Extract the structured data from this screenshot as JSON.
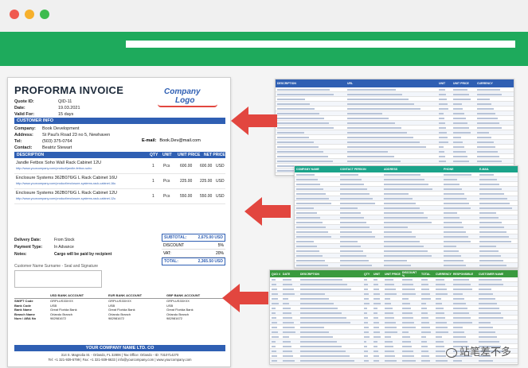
{
  "invoice": {
    "title": "PROFORMA INVOICE",
    "meta": [
      {
        "k": "Quote ID:",
        "v": "QID-11"
      },
      {
        "k": "Date:",
        "v": "19.03.2021"
      },
      {
        "k": "Valid For:",
        "v": "15 days"
      }
    ],
    "logo_line1": "Company",
    "logo_line2": "Logo",
    "customer_header": "CUSTOMER INFO",
    "customer": [
      {
        "k": "Company:",
        "v": "Book Development"
      },
      {
        "k": "Address:",
        "v": "St Paul's Road 23 no 5, Newhaven"
      },
      {
        "k": "Tel:",
        "v": "(503) 375-0764"
      },
      {
        "k": "Contact:",
        "v": "Beatriz Stewart"
      }
    ],
    "email_label": "E-mail:",
    "email_value": "Book.Dev@mail.com",
    "columns": {
      "description": "DESCRIPTION",
      "qty": "QTY",
      "unit": "UNIT",
      "unit_price": "UNIT PRICE",
      "net_price": "NET PRICE"
    },
    "items": [
      {
        "desc": "Jandle Fetbox Soho Wall Rack Cabinet 12U",
        "url": "http://www.yourcompany.com/product/jandle-fetbox-soho",
        "qty": "1",
        "unit": "Pcs",
        "unit_price": "600.00",
        "net": "600.00",
        "cur": "USD"
      },
      {
        "desc": "Enclosure Systems 362B076/G L Rack Cabinet 16U",
        "url": "http://www.yourcompany.com/product/enclosure-systems-rack-cabinet-16u",
        "qty": "1",
        "unit": "Pcs",
        "unit_price": "225.00",
        "net": "225.00",
        "cur": "USD"
      },
      {
        "desc": "Enclosure Systems 362B076/G L Rack Cabinet 12U",
        "url": "http://www.yourcompany.com/product/enclosure-systems-rack-cabinet-12u",
        "qty": "1",
        "unit": "Pcs",
        "unit_price": "550.00",
        "net": "550.00",
        "cur": "USD"
      }
    ],
    "terms": [
      {
        "k": "Delivery Date:",
        "v": "From Stock"
      },
      {
        "k": "Payment Type:",
        "v": "In Advance"
      },
      {
        "k": "Notes:",
        "v": "Cargo will be paid by recipient"
      }
    ],
    "totals": [
      {
        "k": "SUBTOTAL:",
        "v": "2,675.00 USD"
      },
      {
        "k": "DISCOUNT",
        "v": "5%"
      },
      {
        "k": "VAT:",
        "v": "20%"
      },
      {
        "k": "TOTAL:",
        "v": "2,365.50 USD"
      }
    ],
    "signature_label": "Customer Name Surname - Seal and Signature",
    "bank_headers": [
      "USD BANK ACCOUNT",
      "EUR BANK ACCOUNT",
      "GBP BANK ACCOUNT"
    ],
    "bank_rows": [
      {
        "k": "SWIFT Code",
        "v": [
          "GRPLUS33XXX",
          "GRPLUS33XXX",
          "GRPLUS33XXX"
        ]
      },
      {
        "k": "Bank Code",
        "v": [
          "USB",
          "USB",
          "USB"
        ]
      },
      {
        "k": "Bank Name",
        "v": [
          "Great Florida Bank",
          "Great Florida Bank",
          "Great Florida Bank"
        ]
      },
      {
        "k": "Branch Name",
        "v": [
          "Orlando Branch",
          "Orlando Branch",
          "Orlando Branch"
        ]
      },
      {
        "k": "Num / ABA No",
        "v": [
          "982981672",
          "982981672",
          "982981672"
        ]
      }
    ],
    "footer_company": "YOUR COMPANY NAME LTD. CO",
    "footer_address": "314 S. Magnolia St. - Orlando, FL 32806  |  Tax Office: Orlando - ID: 7310714270",
    "footer_contact": "Tel: +1 321-939-5799  |  Fax: +1 321-939-6633  |  info@yourcompany.com  |  www.yourcompany.com"
  },
  "sheet1": {
    "headers": [
      "DESCRIPTION",
      "URL",
      "UNIT",
      "UNIT PRICE",
      "CURRENCY"
    ],
    "header_color": "#2f5fb3",
    "row_count": 22
  },
  "sheet2": {
    "headers": [
      "COMPANY NAME",
      "CONTACT PERSON",
      "ADDRESS",
      "PHONE",
      "E-MAIL"
    ],
    "header_color": "#1aa38a",
    "row_count": 26
  },
  "sheet3": {
    "headers": [
      "QUO #",
      "DATE",
      "DESCRIPTION",
      "QTY",
      "UNIT",
      "UNIT PRICE",
      "DISCOUNT %",
      "TOTAL",
      "CURRENCY",
      "RESPONSIBLE",
      "CUSTOMER NAME"
    ],
    "header_color": "#3a9a3e",
    "row_count": 20
  },
  "watermark": "站笔差不多",
  "colors": {
    "green_band": "#1eaa5c",
    "arrow": "#e2463f",
    "invoice_accent": "#2f5fb3"
  }
}
